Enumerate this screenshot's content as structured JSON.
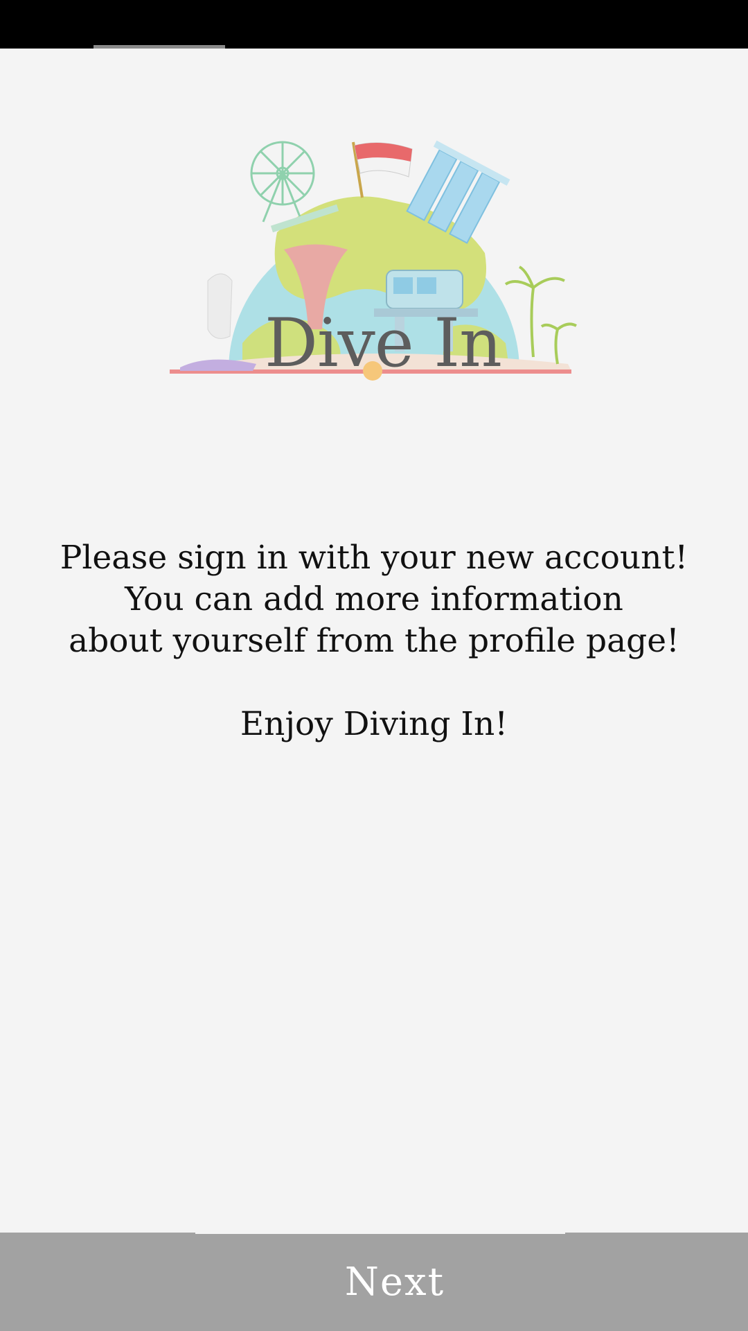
{
  "logo": {
    "text": "Dive In",
    "icon": "singapore-landmarks-illustration"
  },
  "message": {
    "line1": "Please sign in with your new account!",
    "line2": "You can add more information",
    "line3": "about yourself from the profile page!",
    "line4": "Enjoy Diving In!"
  },
  "footer": {
    "next_label": "Next"
  },
  "colors": {
    "background": "#f4f4f4",
    "bottom_bar": "#a2a2a2",
    "status_bar": "#000000"
  }
}
